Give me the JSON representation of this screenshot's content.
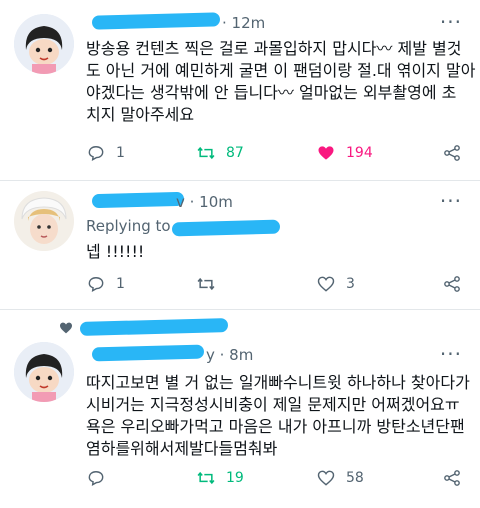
{
  "tweets": [
    {
      "time": "· 12m",
      "text": "방송용 컨텐츠 찍은 걸로 과몰입하지 맙시다〰 제발 별것\n도 아닌 거에 예민하게 굴면 이 팬덤이랑 절.대 엮이지 말아\n야겠다는 생각밖에 안 듭니다〰 얼마없는 외부촬영에 초\n치지 말아주세요",
      "replies": "1",
      "retweets": "87",
      "likes": "194",
      "colors": {
        "like": "#f91880",
        "retweet": "#00ba7c"
      }
    },
    {
      "time": "v · 10m",
      "replying_to": "Replying to",
      "text": "넵 !!!!!!",
      "replies": "1",
      "retweets": "",
      "likes": "3"
    },
    {
      "time": "y · 8m",
      "text": "따지고보면 별 거 없는 일개빠수니트윗 하나하나 찾아다가\n시비거는 지극정성시비충이 제일 문제지만 어쩌겠어요ㅠ\n욕은 우리오빠가먹고 마음은 내가 아프니까 방탄소년단팬\n염하를위해서제발다들멈춰봐",
      "replies": "",
      "retweets": "19",
      "likes": "58"
    }
  ],
  "icons": {
    "more": "more-dots-icon",
    "reply": "reply-bubble-icon",
    "retweet": "retweet-icon",
    "like": "heart-icon",
    "share": "share-icon"
  },
  "colors": {
    "redaction": "#29b6f6",
    "muted": "#536471",
    "separator": "#e3e7ea"
  }
}
